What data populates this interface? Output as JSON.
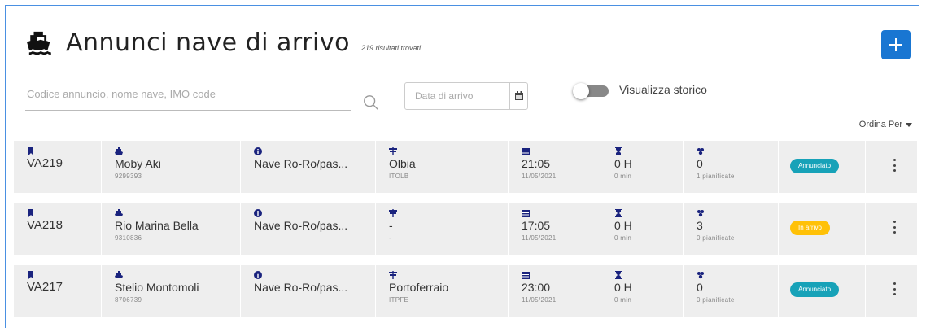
{
  "header": {
    "title": "Annunci nave di arrivo",
    "count_label": "219 risultati trovati"
  },
  "search": {
    "placeholder": "Codice annuncio, nome nave, IMO code"
  },
  "date_filter": {
    "placeholder": "Data di arrivo"
  },
  "history_toggle": {
    "label": "Visualizza storico",
    "checked": false
  },
  "sort": {
    "label": "Ordina Per"
  },
  "colors": {
    "accent": "#1976d2",
    "badge_announced": "#17a2b8",
    "badge_in_progress": "#ffc107",
    "row_bg": "#eeeeee"
  },
  "rows": [
    {
      "code": "VA219",
      "ship_name": "Moby Aki",
      "imo": "9299393",
      "ship_type": "Nave Ro-Ro/pas...",
      "port": "Olbia",
      "port_code": "ITOLB",
      "time": "21:05",
      "date": "11/05/2021",
      "duration_h": "0 H",
      "duration_min": "0 min",
      "count": "0",
      "planned": "1 pianificate",
      "status": "Annunciato",
      "status_kind": "announced"
    },
    {
      "code": "VA218",
      "ship_name": "Rio Marina Bella",
      "imo": "9310836",
      "ship_type": "Nave Ro-Ro/pas...",
      "port": "-",
      "port_code": "-",
      "time": "17:05",
      "date": "11/05/2021",
      "duration_h": "0 H",
      "duration_min": "0 min",
      "count": "3",
      "planned": "0 pianificate",
      "status": "In arrivo",
      "status_kind": "in_progress"
    },
    {
      "code": "VA217",
      "ship_name": "Stelio Montomoli",
      "imo": "8706739",
      "ship_type": "Nave Ro-Ro/pas...",
      "port": "Portoferraio",
      "port_code": "ITPFE",
      "time": "23:00",
      "date": "11/05/2021",
      "duration_h": "0 H",
      "duration_min": "0 min",
      "count": "0",
      "planned": "0 pianificate",
      "status": "Annunciato",
      "status_kind": "announced"
    }
  ]
}
